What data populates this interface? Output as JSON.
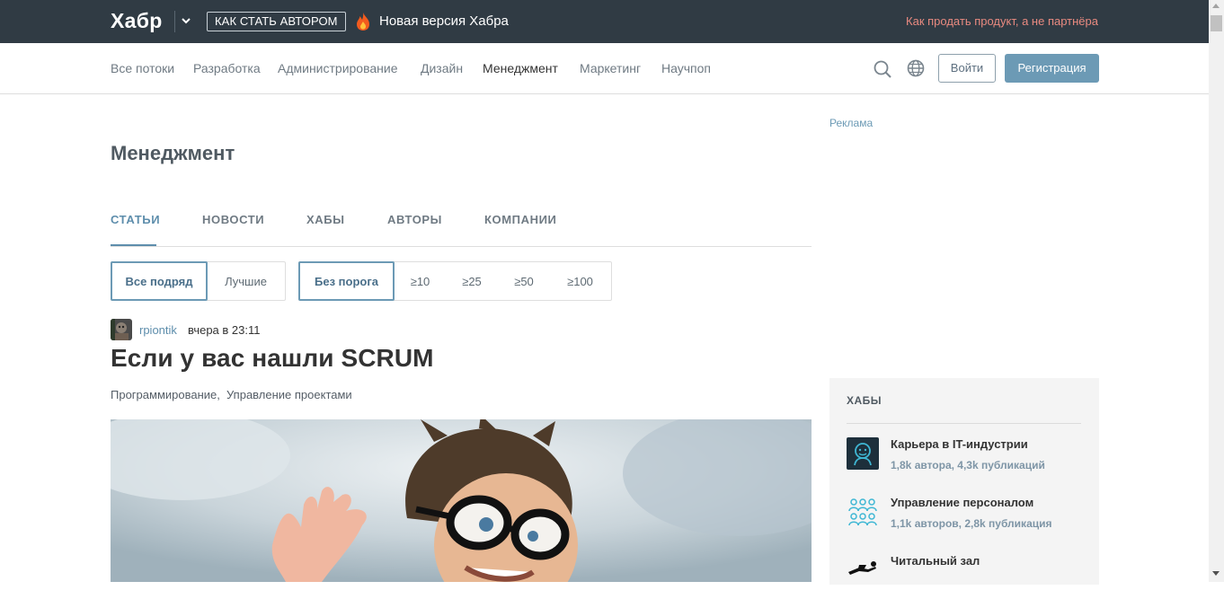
{
  "topbar": {
    "logo": "Хабр",
    "author_button": "КАК СТАТЬ АВТОРОМ",
    "new_version": "Новая версия Хабра",
    "promo": "Как продать продукт, а не партнёра"
  },
  "nav": {
    "items": [
      "Все потоки",
      "Разработка",
      "Администрирование",
      "Дизайн",
      "Менеджмент",
      "Маркетинг",
      "Научпоп"
    ],
    "active": "Менеджмент",
    "login": "Войти",
    "register": "Регистрация"
  },
  "main": {
    "title": "Менеджмент",
    "tabs": [
      "СТАТЬИ",
      "НОВОСТИ",
      "ХАБЫ",
      "АВТОРЫ",
      "КОМПАНИИ"
    ],
    "filters_a": [
      "Все подряд",
      "Лучшие"
    ],
    "filters_b": [
      "Без порога",
      "≥10",
      "≥25",
      "≥50",
      "≥100"
    ]
  },
  "post": {
    "author": "rpiontik",
    "time": "вчера в 23:11",
    "title": "Если у вас нашли SCRUM",
    "hubs": [
      "Программирование,",
      "Управление проектами"
    ]
  },
  "sidebar": {
    "ad_label": "Реклама",
    "hubs_title": "ХАБЫ",
    "hubs": [
      {
        "name": "Карьера в IT-индустрии",
        "stats": "1,8k автора, 4,3k публикаций"
      },
      {
        "name": "Управление персоналом",
        "stats": "1,1k авторов, 2,8k публикация"
      },
      {
        "name": "Читальный зал",
        "stats": ""
      }
    ]
  },
  "colors": {
    "topbar_bg": "#303b44",
    "accent": "#6c9ab5",
    "promo": "#e98a80"
  }
}
